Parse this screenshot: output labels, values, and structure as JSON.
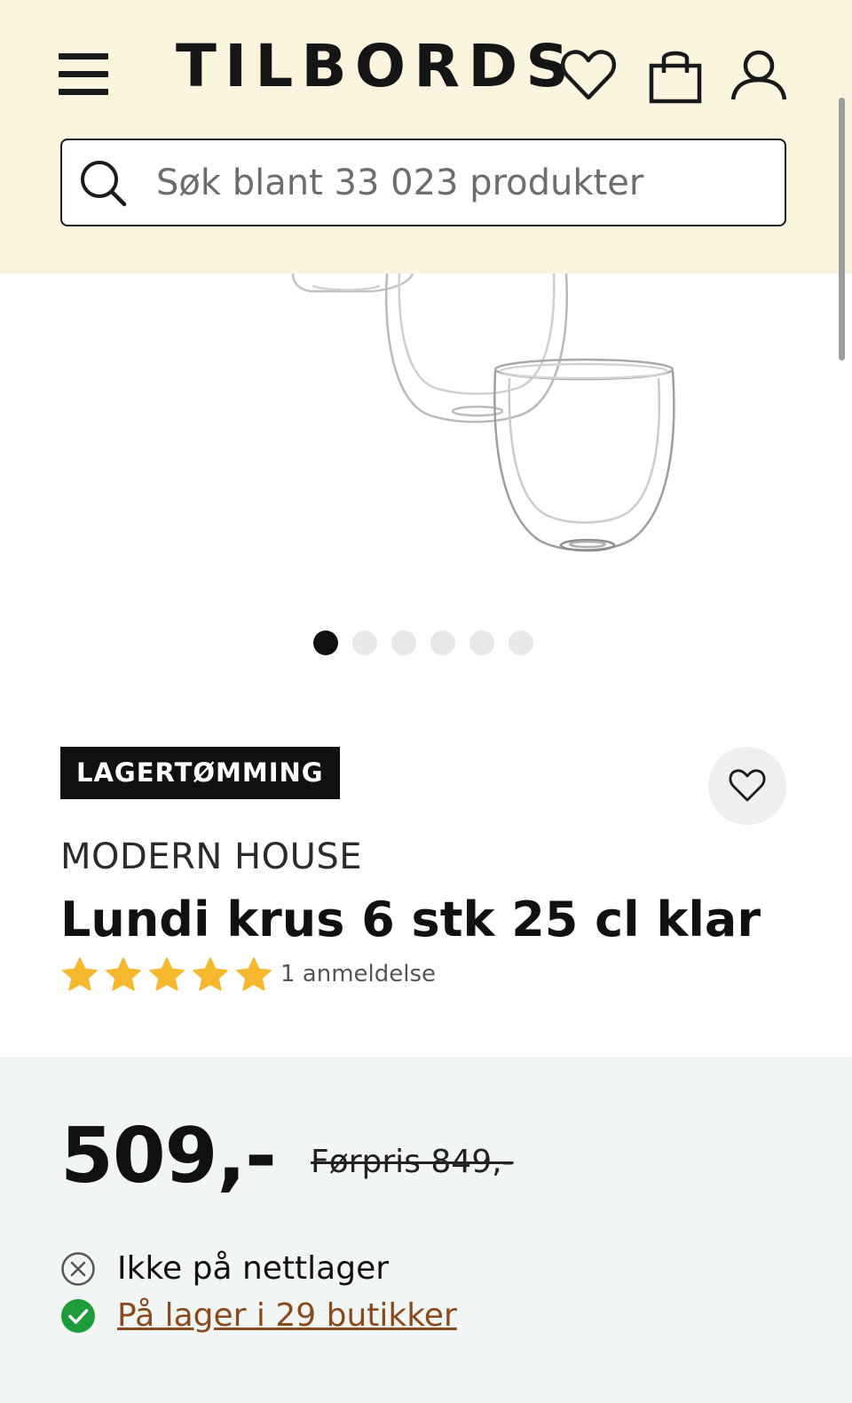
{
  "header": {
    "logo": "TILBORDS",
    "search_placeholder": "Søk blant 33 023 produkter",
    "icons": [
      "menu-icon",
      "heart-icon",
      "shopping-bag-icon",
      "user-icon",
      "search-icon"
    ]
  },
  "gallery": {
    "image_count": 6,
    "active_index": 0
  },
  "product": {
    "badge": "LAGERTØMMING",
    "brand": "MODERN HOUSE",
    "title": "Lundi krus 6 stk 25 cl klar",
    "rating": 5,
    "rating_max": 5,
    "reviews_label": "1 anmeldelse"
  },
  "price": {
    "current": "509,-",
    "previous": "Førpris 849,-"
  },
  "stock": {
    "online": "Ikke på nettlager",
    "stores": "På lager i 29 butikker"
  },
  "colors": {
    "header_bg": "#fbf4de",
    "price_panel_bg": "#f1f6f4",
    "star": "#f5b82e",
    "in_stock": "#1e9b3a",
    "link": "#8a4a1e"
  }
}
